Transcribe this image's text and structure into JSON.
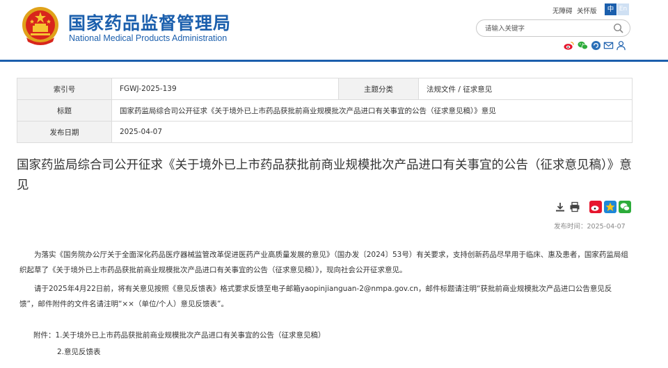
{
  "header": {
    "site_title_cn": "国家药品监督管理局",
    "site_title_en": "National Medical Products Administration",
    "brand_color": "#1b5fad",
    "top_links": {
      "accessibility": "无障碍",
      "elderly_mode": "关怀版"
    },
    "lang": {
      "cn": "中",
      "en": "En"
    },
    "search": {
      "placeholder": "请输入关键字",
      "icon": "search-icon"
    },
    "social_icons": [
      "weibo-icon",
      "wechat-icon",
      "mail-icon",
      "user-icon"
    ]
  },
  "info_table": {
    "index_label": "索引号",
    "index_value": "FGWJ-2025-139",
    "category_label": "主题分类",
    "category_value": "法规文件 / 征求意见",
    "title_label": "标题",
    "title_value": "国家药监局综合司公开征求《关于境外已上市药品获批前商业规模批次产品进口有关事宜的公告（征求意见稿）》意见",
    "date_label": "发布日期",
    "date_value": "2025-04-07"
  },
  "article": {
    "title": "国家药监局综合司公开征求《关于境外已上市药品获批前商业规模批次产品进口有关事宜的公告（征求意见稿）》意见",
    "tools": [
      "download-icon",
      "print-icon"
    ],
    "share": [
      "weibo-share-icon",
      "qzone-share-icon",
      "wechat-share-icon"
    ],
    "publish_time": "发布时间：2025-04-07",
    "para1": "为落实《国务院办公厅关于全面深化药品医疗器械监管改革促进医药产业高质量发展的意见》（国办发〔2024〕53号）有关要求，支持创新药品尽早用于临床、惠及患者，国家药监局组织起草了《关于境外已上市药品获批前商业规模批次产品进口有关事宜的公告（征求意见稿）》，现向社会公开征求意见。",
    "para2": "请于2025年4月22日前，将有关意见按照《意见反馈表》格式要求反馈至电子邮箱yaopinjianguan-2@nmpa.gov.cn，邮件标题请注明“获批前商业规模批次产品进口公告意见反馈”，邮件附件的文件名请注明“××（单位/个人）意见反馈表”。",
    "attachment_prefix": "附件：",
    "attachment1": "1.关于境外已上市药品获批前商业规模批次产品进口有关事宜的公告（征求意见稿）",
    "attachment2": "2.意见反馈表"
  }
}
